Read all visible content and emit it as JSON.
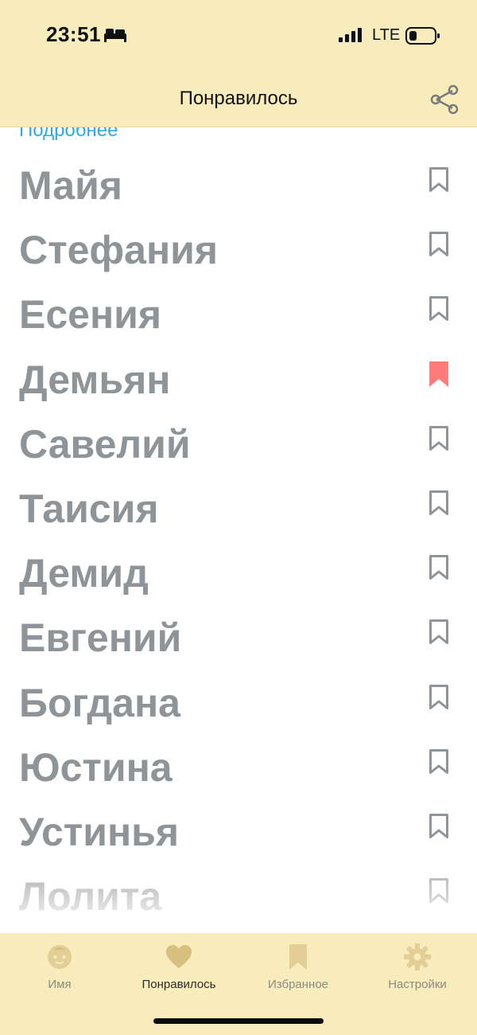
{
  "status_bar": {
    "time": "23:51",
    "network": "LTE",
    "sleep_icon": "bed-icon",
    "signal_icon": "signal-icon",
    "battery_icon": "battery-icon"
  },
  "header": {
    "title": "Понравилось",
    "share_icon": "share-icon"
  },
  "list": {
    "details_link": "Подробнее",
    "items": [
      {
        "name": "Майя",
        "bookmarked": false
      },
      {
        "name": "Стефания",
        "bookmarked": false
      },
      {
        "name": "Есения",
        "bookmarked": false
      },
      {
        "name": "Демьян",
        "bookmarked": true
      },
      {
        "name": "Савелий",
        "bookmarked": false
      },
      {
        "name": "Таисия",
        "bookmarked": false
      },
      {
        "name": "Демид",
        "bookmarked": false
      },
      {
        "name": "Евгений",
        "bookmarked": false
      },
      {
        "name": "Богдана",
        "bookmarked": false
      },
      {
        "name": "Юстина",
        "bookmarked": false
      },
      {
        "name": "Устинья",
        "bookmarked": false
      },
      {
        "name": "Лолита",
        "bookmarked": false
      }
    ]
  },
  "tabbar": {
    "tabs": [
      {
        "label": "Имя",
        "icon": "baby-face-icon",
        "active": false
      },
      {
        "label": "Понравилось",
        "icon": "heart-icon",
        "active": true
      },
      {
        "label": "Избранное",
        "icon": "bookmark-icon",
        "active": false
      },
      {
        "label": "Настройки",
        "icon": "gear-icon",
        "active": false
      }
    ]
  },
  "colors": {
    "bar_background": "#f8ebbc",
    "name_text": "#8e9498",
    "bookmark_outline": "#8e9498",
    "bookmark_active": "#ff7b7b",
    "link": "#2fa8e6",
    "tab_icon_inactive": "#e3cf95",
    "tab_icon_active": "#d8c07e"
  }
}
